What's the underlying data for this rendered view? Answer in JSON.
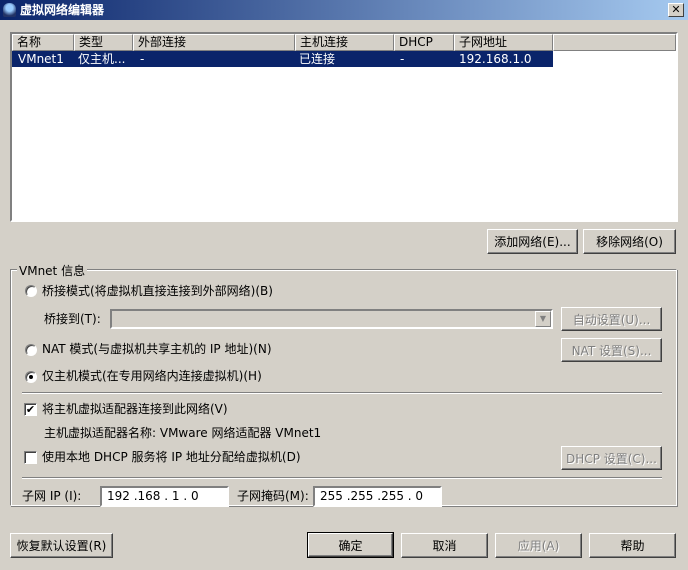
{
  "window": {
    "title": "虚拟网络编辑器",
    "close": "✕"
  },
  "table": {
    "columns": [
      "名称",
      "类型",
      "外部连接",
      "主机连接",
      "DHCP",
      "子网地址"
    ],
    "rows": [
      [
        "VMnet1",
        "仅主机...",
        "-",
        "已连接",
        "-",
        "192.168.1.0"
      ]
    ]
  },
  "buttons": {
    "add": "添加网络(E)...",
    "remove": "移除网络(O)",
    "auto": "自动设置(U)...",
    "nat": "NAT 设置(S)...",
    "dhcp": "DHCP 设置(C)...",
    "restore": "恢复默认设置(R)",
    "ok": "确定",
    "cancel": "取消",
    "apply": "应用(A)",
    "help": "帮助"
  },
  "info": {
    "group_label": "VMnet 信息",
    "bridged": "桥接模式(将虚拟机直接连接到外部网络)(B)",
    "bridge_to": "桥接到(T):",
    "bridge_value": "",
    "nat_mode": "NAT 模式(与虚拟机共享主机的 IP 地址)(N)",
    "host_only": "仅主机模式(在专用网络内连接虚拟机)(H)",
    "selected_mode": "host_only",
    "connect_adapter": "将主机虚拟适配器连接到此网络(V)",
    "connect_adapter_checked": true,
    "adapter_name": "主机虚拟适配器名称: VMware 网络适配器 VMnet1",
    "use_dhcp": "使用本地 DHCP 服务将 IP 地址分配给虚拟机(D)",
    "use_dhcp_checked": false,
    "subnet_ip_label": "子网 IP (I):",
    "subnet_ip": "192 .168 . 1  .  0",
    "mask_label": "子网掩码(M):",
    "mask": "255 .255 .255 .  0"
  }
}
